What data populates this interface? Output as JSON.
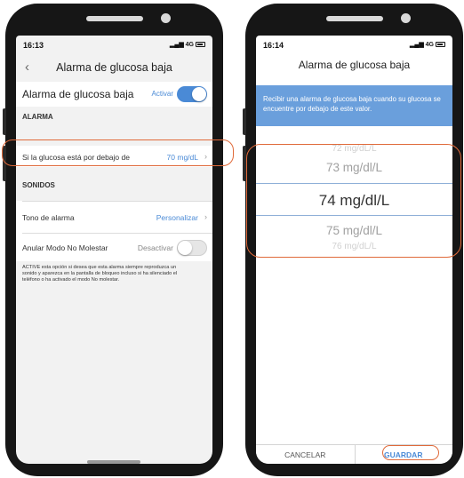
{
  "left_screen": {
    "status": {
      "time": "16:13",
      "network": "4G"
    },
    "nav": {
      "back": "‹",
      "title": "Alarma de glucosa baja"
    },
    "main_toggle": {
      "label": "Alarma de glucosa baja",
      "state_label": "Activar",
      "on": true
    },
    "alarm_section": {
      "header": "ALARMA",
      "threshold_label": "Si la glucosa está por debajo de",
      "threshold_value": "70 mg/dL"
    },
    "sounds_section": {
      "header": "SONIDOS",
      "tone_label": "Tono de alarma",
      "tone_value": "Personalizar"
    },
    "dnd": {
      "label": "Anular Modo No Molestar",
      "state_label": "Desactivar",
      "on": false,
      "note": "ACTIVE esta opción si desea que esta alarma siempre reproduzca un sonido y aparezca en la pantalla de bloqueo incluso si ha silenciado el teléfono o ha activado el modo No molestar."
    }
  },
  "right_screen": {
    "status": {
      "time": "16:14",
      "network": "4G"
    },
    "title": "Alarma de glucosa baja",
    "banner": "Recibir una alarma de glucosa baja cuando su glucosa se encuentre por debajo de este valor.",
    "picker": {
      "faint_above": "72 mg/dL/L",
      "above": "73 mg/dl/L",
      "selected": "74 mg/dl/L",
      "below": "75 mg/dl/L",
      "faint_below": "76 mg/dL/L"
    },
    "footer": {
      "cancel": "CANCELAR",
      "save": "GUARDAR"
    }
  },
  "colors": {
    "accent": "#4a8ad6",
    "banner": "#6a9fdc",
    "highlight": "#e06a3a"
  }
}
